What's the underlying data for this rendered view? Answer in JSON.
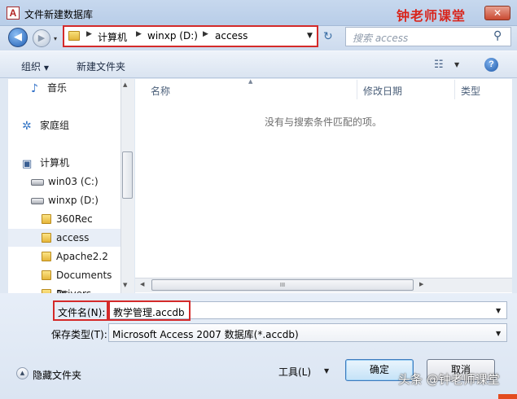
{
  "window": {
    "app_icon_glyph": "A",
    "title": "文件新建数据库",
    "watermark_top": "钟老师课堂",
    "close_glyph": "✕"
  },
  "nav": {
    "back_glyph": "◀",
    "forward_glyph": "▶",
    "dropdown_glyph": "▾",
    "address": [
      "计算机",
      "winxp (D:)",
      "access"
    ],
    "address_sep": "▶",
    "address_dropdown": "▼",
    "refresh_glyph": "↻",
    "search_placeholder": "搜索 access",
    "search_glyph": "⚲"
  },
  "toolbar": {
    "organize": "组织",
    "organize_arrow": "▼",
    "new_folder": "新建文件夹",
    "view_glyph": "☷",
    "view_arrow": "▼",
    "help_glyph": "?"
  },
  "tree": {
    "items": [
      {
        "label": "音乐",
        "icon": "music-icon",
        "glyph": "♪"
      },
      {
        "label": "家庭组",
        "icon": "homegroup-icon",
        "glyph": "✲"
      },
      {
        "label": "计算机",
        "icon": "computer-icon",
        "glyph": "▣"
      },
      {
        "label": "win03 (C:)",
        "icon": "drive-icon",
        "glyph": ""
      },
      {
        "label": "winxp (D:)",
        "icon": "drive-icon",
        "glyph": ""
      },
      {
        "label": "360Rec",
        "icon": "folder-icon",
        "glyph": ""
      },
      {
        "label": "access",
        "icon": "folder-icon",
        "glyph": ""
      },
      {
        "label": "Apache2.2",
        "icon": "folder-icon",
        "glyph": ""
      },
      {
        "label": "Documents ar",
        "icon": "folder-icon",
        "glyph": ""
      },
      {
        "label": "Drivers",
        "icon": "folder-icon",
        "glyph": ""
      }
    ],
    "selected_index": 6,
    "scroll_up": "▲",
    "scroll_down": "▼"
  },
  "files": {
    "columns": [
      "名称",
      "修改日期",
      "类型"
    ],
    "sort_glyph": "▲",
    "empty_message": "没有与搜索条件匹配的项。",
    "scroll_left": "◀",
    "scroll_right": "▶",
    "thumb_grip": "III"
  },
  "form": {
    "filename_label": "文件名(N):",
    "filename_value": "教学管理.accdb",
    "filename_dropdown": "▼",
    "filetype_label": "保存类型(T):",
    "filetype_value": "Microsoft Access 2007 数据库(*.accdb)",
    "filetype_dropdown": "▼",
    "hide_folders_glyph": "▲",
    "hide_folders": "隐藏文件夹",
    "tools": "工具(L)",
    "tools_arrow": "▼",
    "ok": "确定",
    "cancel": "取消"
  },
  "watermark_bottom": "头条 @钟老师课堂",
  "colors": {
    "highlight_border": "#d42a2a",
    "watermark_red": "#d9251c",
    "window_bg": "#dfe8f3"
  }
}
